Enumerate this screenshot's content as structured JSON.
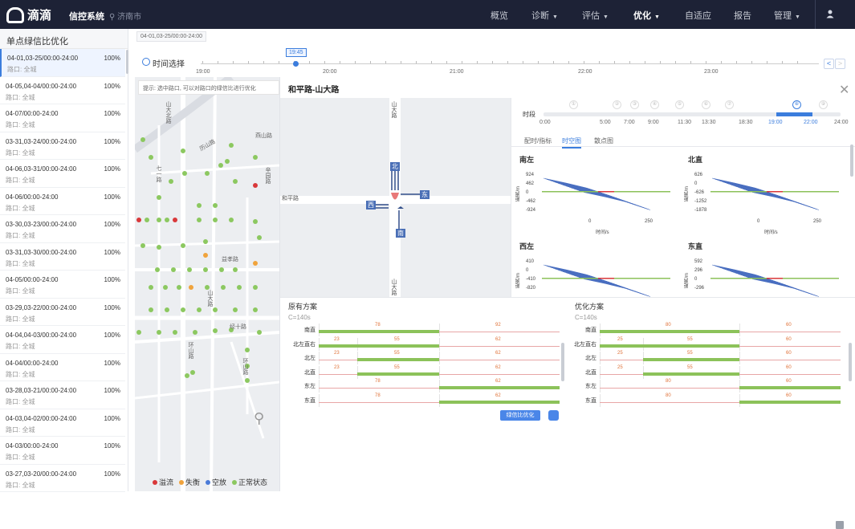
{
  "app": {
    "logo_text": "滴滴",
    "system_name": "信控系统",
    "city": "济南市"
  },
  "nav": [
    {
      "label": "概览",
      "caret": false,
      "active": false
    },
    {
      "label": "诊断",
      "caret": true,
      "active": false
    },
    {
      "label": "评估",
      "caret": true,
      "active": false
    },
    {
      "label": "优化",
      "caret": true,
      "active": true
    },
    {
      "label": "自适应",
      "caret": false,
      "active": false
    },
    {
      "label": "报告",
      "caret": false,
      "active": false
    },
    {
      "label": "管理",
      "caret": true,
      "active": false
    }
  ],
  "sidebar": {
    "title": "单点绿信比优化",
    "sub_prefix": "路口: 全城",
    "items": [
      {
        "name": "04-01,03-25/00:00-24:00",
        "pct": "100%",
        "sub": "路口: 全城",
        "selected": true
      },
      {
        "name": "04-05,04-04/00:00-24:00",
        "pct": "100%",
        "sub": "路口: 全城",
        "selected": false
      },
      {
        "name": "04-07/00:00-24:00",
        "pct": "100%",
        "sub": "路口: 全城",
        "selected": false
      },
      {
        "name": "03-31,03-24/00:00-24:00",
        "pct": "100%",
        "sub": "路口: 全城",
        "selected": false
      },
      {
        "name": "04-06,03-31/00:00-24:00",
        "pct": "100%",
        "sub": "路口: 全城",
        "selected": false
      },
      {
        "name": "04-06/00:00-24:00",
        "pct": "100%",
        "sub": "路口: 全城",
        "selected": false
      },
      {
        "name": "03-30,03-23/00:00-24:00",
        "pct": "100%",
        "sub": "路口: 全城",
        "selected": false
      },
      {
        "name": "03-31,03-30/00:00-24:00",
        "pct": "100%",
        "sub": "路口: 全城",
        "selected": false
      },
      {
        "name": "04-05/00:00-24:00",
        "pct": "100%",
        "sub": "路口: 全城",
        "selected": false
      },
      {
        "name": "03-29,03-22/00:00-24:00",
        "pct": "100%",
        "sub": "路口: 全城",
        "selected": false
      },
      {
        "name": "04-04,04-03/00:00-24:00",
        "pct": "100%",
        "sub": "路口: 全城",
        "selected": false
      },
      {
        "name": "04-04/00:00-24:00",
        "pct": "100%",
        "sub": "路口: 全城",
        "selected": false
      },
      {
        "name": "03-28,03-21/00:00-24:00",
        "pct": "100%",
        "sub": "路口: 全城",
        "selected": false
      },
      {
        "name": "04-03,04-02/00:00-24:00",
        "pct": "100%",
        "sub": "路口: 全城",
        "selected": false
      },
      {
        "name": "04-03/00:00-24:00",
        "pct": "100%",
        "sub": "路口: 全城",
        "selected": false
      },
      {
        "name": "03-27,03-20/00:00-24:00",
        "pct": "100%",
        "sub": "路口: 全城",
        "selected": false
      }
    ]
  },
  "timeline": {
    "date_chip": "04-01,03-25/00:00-24:00",
    "label": "时间选择",
    "current": "19:45",
    "ticks": [
      "19:00",
      "20:00",
      "21:00",
      "22:00",
      "23:00"
    ]
  },
  "map": {
    "hint": "提示: 选中路口, 可以对路口的绿信比进行优化",
    "roads": [
      "山大北路",
      "七一路",
      "历山路",
      "燕山路",
      "辛园路",
      "益孝路",
      "山大路",
      "经十路",
      "环山路",
      "和平路",
      "燕子山路"
    ],
    "legend": [
      {
        "label": "溢流",
        "color": "#d9383a"
      },
      {
        "label": "失衡",
        "color": "#f0a33c"
      },
      {
        "label": "空放",
        "color": "#4a7bd8"
      },
      {
        "label": "正常状态",
        "color": "#8cc860"
      }
    ]
  },
  "detail": {
    "title": "和平路-山大路",
    "intersection": {
      "north": "北",
      "south": "南",
      "east": "东",
      "west": "西",
      "road_ew": "和平路",
      "road_ns": "山大路"
    },
    "period": {
      "label": "时段",
      "ticks": [
        "0:00",
        "5:00",
        "7:00",
        "9:00",
        "11:30",
        "13:30",
        "18:30",
        "19:00",
        "22:00",
        "24:00"
      ],
      "selected_index": 7,
      "markers": [
        "①",
        "②",
        "③",
        "④",
        "⑤",
        "⑥",
        "⑦",
        "⑧",
        "⑨"
      ]
    },
    "tabs": [
      {
        "label": "配时/指标",
        "active": false
      },
      {
        "label": "时空图",
        "active": true
      },
      {
        "label": "散点图",
        "active": false
      }
    ],
    "ts_charts": [
      {
        "title": "南左",
        "yticks": [
          "924",
          "462",
          "0",
          "-462",
          "-924"
        ],
        "xticks": [
          "0",
          "250"
        ],
        "xlabel": "时间/s",
        "ylabel": "距离/m"
      },
      {
        "title": "北直",
        "yticks": [
          "626",
          "0",
          "-626",
          "-1252",
          "-1878"
        ],
        "xticks": [
          "0",
          "250"
        ],
        "xlabel": "时间/s",
        "ylabel": "距离/m"
      },
      {
        "title": "西左",
        "yticks": [
          "410",
          "0",
          "-410",
          "-820"
        ],
        "xticks": [],
        "xlabel": "",
        "ylabel": "距离/m"
      },
      {
        "title": "东直",
        "yticks": [
          "592",
          "296",
          "0",
          "-296"
        ],
        "xticks": [],
        "xlabel": "",
        "ylabel": "距离/m"
      }
    ]
  },
  "plans": {
    "original": {
      "title": "原有方案",
      "cycle": "C=140s",
      "rows": [
        {
          "label": "南直",
          "segs": [
            {
              "n": "78",
              "s": 0,
              "e": 0.5
            },
            {
              "n": "92",
              "s": 0.5,
              "e": 1.0,
              "bar": false
            }
          ]
        },
        {
          "label": "北左直右",
          "segs": [
            {
              "n": "23",
              "s": 0,
              "e": 0.16
            },
            {
              "n": "55",
              "s": 0.16,
              "e": 0.5
            },
            {
              "n": "62",
              "s": 0.5,
              "e": 1.0,
              "bar": false
            }
          ]
        },
        {
          "label": "北左",
          "segs": [
            {
              "n": "23",
              "s": 0,
              "e": 0.16,
              "bar": false
            },
            {
              "n": "55",
              "s": 0.16,
              "e": 0.5
            },
            {
              "n": "62",
              "s": 0.5,
              "e": 1.0,
              "bar": false
            }
          ]
        },
        {
          "label": "北直",
          "segs": [
            {
              "n": "23",
              "s": 0,
              "e": 0.16,
              "bar": false
            },
            {
              "n": "55",
              "s": 0.16,
              "e": 0.5
            },
            {
              "n": "62",
              "s": 0.5,
              "e": 1.0,
              "bar": false
            }
          ]
        },
        {
          "label": "东左",
          "segs": [
            {
              "n": "78",
              "s": 0,
              "e": 0.5,
              "bar": false
            },
            {
              "n": "62",
              "s": 0.5,
              "e": 1.0
            }
          ]
        },
        {
          "label": "东直",
          "segs": [
            {
              "n": "78",
              "s": 0,
              "e": 0.5,
              "bar": false
            },
            {
              "n": "62",
              "s": 0.5,
              "e": 1.0
            }
          ]
        }
      ]
    },
    "optimized": {
      "title": "优化方案",
      "cycle": "C=140s",
      "rows": [
        {
          "label": "南直",
          "segs": [
            {
              "n": "80",
              "s": 0,
              "e": 0.58
            },
            {
              "n": "60",
              "s": 0.58,
              "e": 1.0,
              "bar": false
            }
          ]
        },
        {
          "label": "北左直右",
          "segs": [
            {
              "n": "25",
              "s": 0,
              "e": 0.18
            },
            {
              "n": "55",
              "s": 0.18,
              "e": 0.58
            },
            {
              "n": "60",
              "s": 0.58,
              "e": 1.0,
              "bar": false
            }
          ]
        },
        {
          "label": "北左",
          "segs": [
            {
              "n": "25",
              "s": 0,
              "e": 0.18,
              "bar": false
            },
            {
              "n": "55",
              "s": 0.18,
              "e": 0.58
            },
            {
              "n": "60",
              "s": 0.58,
              "e": 1.0,
              "bar": false
            }
          ]
        },
        {
          "label": "北直",
          "segs": [
            {
              "n": "25",
              "s": 0,
              "e": 0.18,
              "bar": false
            },
            {
              "n": "55",
              "s": 0.18,
              "e": 0.58
            },
            {
              "n": "60",
              "s": 0.58,
              "e": 1.0,
              "bar": false
            }
          ]
        },
        {
          "label": "东左",
          "segs": [
            {
              "n": "80",
              "s": 0,
              "e": 0.58,
              "bar": false
            },
            {
              "n": "60",
              "s": 0.58,
              "e": 1.0
            }
          ]
        },
        {
          "label": "东直",
          "segs": [
            {
              "n": "80",
              "s": 0,
              "e": 0.58,
              "bar": false
            },
            {
              "n": "60",
              "s": 0.58,
              "e": 1.0
            }
          ]
        }
      ]
    },
    "optimize_button": "绿信比优化"
  },
  "colors": {
    "topbar": "#1d2236",
    "accent": "#3b7ddd",
    "green": "#8cc25a",
    "red": "#d9383a",
    "orange": "#f0a33c"
  }
}
